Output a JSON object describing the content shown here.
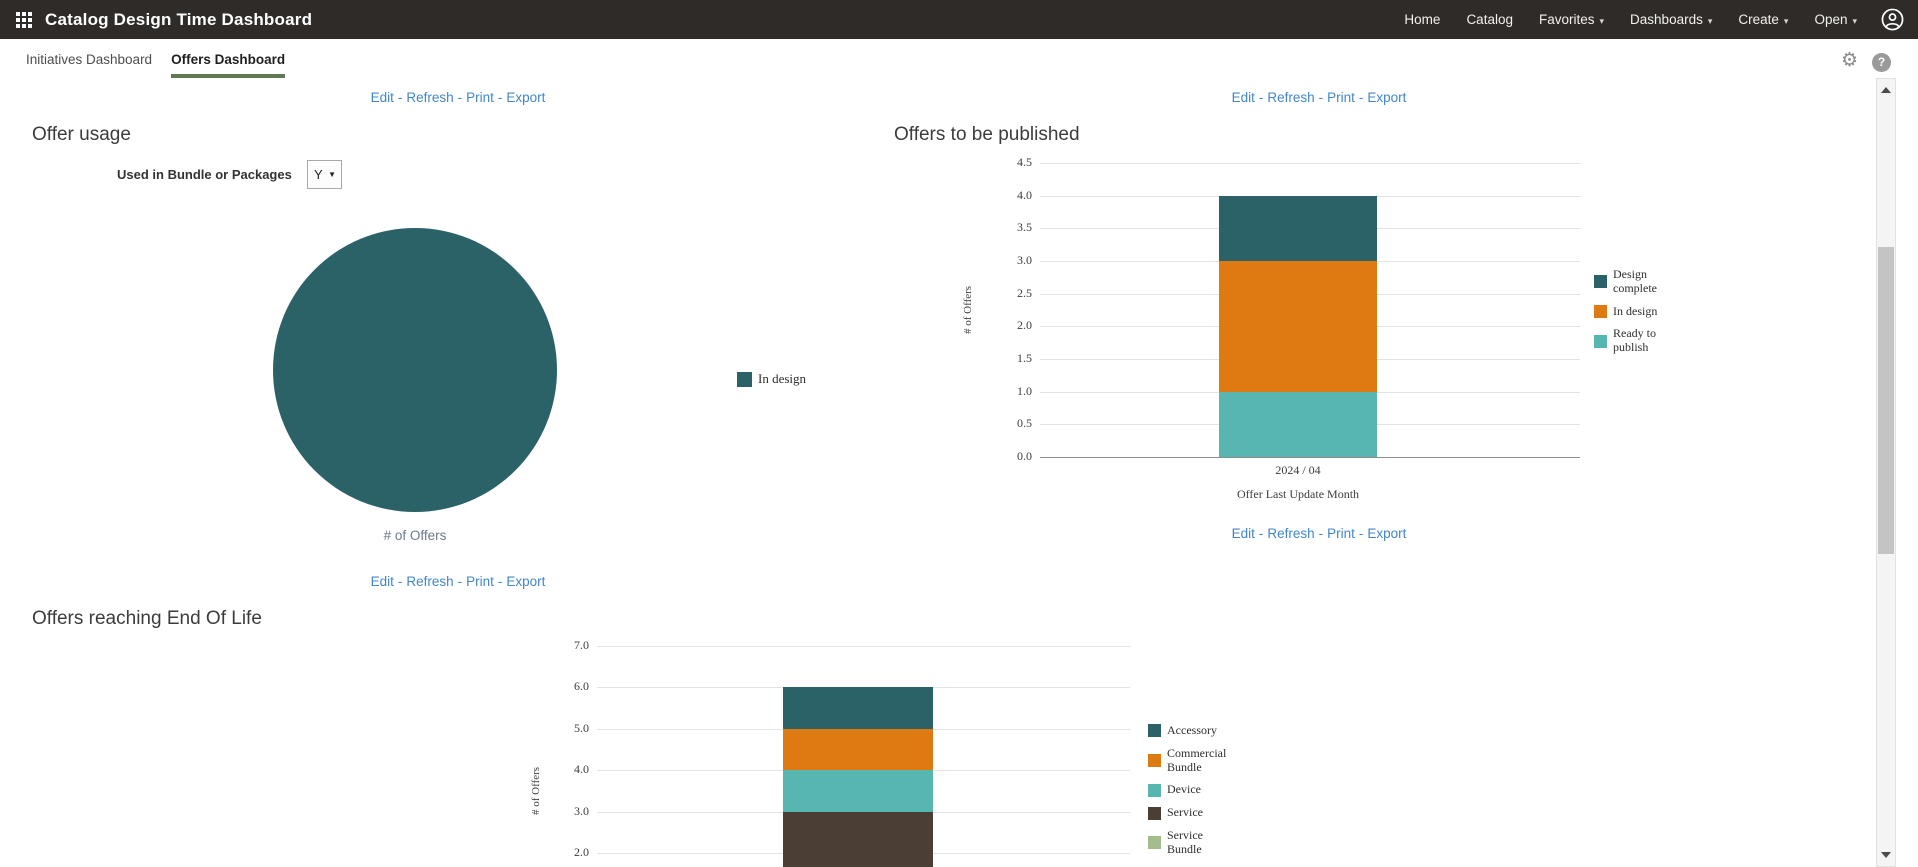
{
  "header": {
    "title": "Catalog Design Time Dashboard",
    "nav_items": [
      {
        "label": "Home",
        "has_dropdown": false
      },
      {
        "label": "Catalog",
        "has_dropdown": false
      },
      {
        "label": "Favorites",
        "has_dropdown": true
      },
      {
        "label": "Dashboards",
        "has_dropdown": true
      },
      {
        "label": "Create",
        "has_dropdown": true
      },
      {
        "label": "Open",
        "has_dropdown": true
      }
    ]
  },
  "tab_bar": {
    "tabs": [
      {
        "label": "Initiatives Dashboard",
        "active": false
      },
      {
        "label": "Offers Dashboard",
        "active": true
      }
    ],
    "icons": [
      "settings-gear",
      "help"
    ]
  },
  "action_links": [
    "Edit",
    "Refresh",
    "Print",
    "Export"
  ],
  "filters": {
    "used_in_bundle_label": "Used in Bundle or Packages",
    "used_in_bundle_value": "Y"
  },
  "chart_data": [
    {
      "id": "offer-usage-pie",
      "type": "pie",
      "title": "Offer usage",
      "slices": [
        {
          "label": "In design",
          "fraction": 1.0,
          "color": "#2A6268"
        }
      ],
      "footer_label": "# of Offers",
      "legend_position": "right"
    },
    {
      "id": "offers-to-be-published",
      "type": "bar",
      "stacked": true,
      "title": "Offers to be published",
      "categories": [
        "2024 / 04"
      ],
      "series": [
        {
          "name": "Design complete",
          "color": "#2A6268",
          "values": [
            1
          ],
          "from": 3,
          "to": 4
        },
        {
          "name": "In design",
          "color": "#DD7B12",
          "values": [
            2
          ],
          "from": 1,
          "to": 3
        },
        {
          "name": "Ready to publish",
          "color": "#58B6B0",
          "values": [
            1
          ],
          "from": 0,
          "to": 1
        }
      ],
      "xlabel": "Offer Last Update Month",
      "ylabel": "# of Offers",
      "ylim": [
        0,
        4.5
      ],
      "y_ticks": [
        "4.5",
        "4.0",
        "3.5",
        "3.0",
        "2.5",
        "2.0",
        "1.5",
        "1.0",
        "0.5",
        "0.0"
      ],
      "grid": true,
      "legend_position": "right"
    },
    {
      "id": "offers-reaching-eol",
      "type": "bar",
      "stacked": true,
      "title": "Offers reaching End Of Life",
      "categories": [],
      "series": [
        {
          "name": "Accessory",
          "color": "#2A6268",
          "values": [
            1
          ],
          "from": 5,
          "to": 6
        },
        {
          "name": "Commercial Bundle",
          "color": "#DD7B12",
          "values": [
            1
          ],
          "from": 4,
          "to": 5
        },
        {
          "name": "Device",
          "color": "#58B6B0",
          "values": [
            1
          ],
          "from": 3,
          "to": 4
        },
        {
          "name": "Service",
          "color": "#4A3E35",
          "values": [
            null
          ],
          "from": null,
          "to": 3,
          "note": "segment bottom cut off by viewport edge"
        },
        {
          "name": "Service Bundle",
          "color": "#A4BD8D",
          "values": [
            null
          ],
          "from": null,
          "to": null,
          "note": "legend entry visible; segment below viewport"
        }
      ],
      "ylabel": "# of Offers",
      "y_ticks": [
        "7.0",
        "6.0",
        "5.0",
        "4.0",
        "3.0",
        "2.0"
      ],
      "ylim_visible": [
        2,
        7
      ],
      "grid": true,
      "legend_position": "right"
    }
  ],
  "colors": {
    "header_bg": "#2F2B28",
    "link_blue": "#4187C8",
    "tab_active_underline": "#5F7A50",
    "teal_dark": "#2A6268",
    "orange": "#DD7B12",
    "teal_light": "#58B6B0",
    "brown": "#4A3E35",
    "green_light": "#A4BD8D"
  }
}
